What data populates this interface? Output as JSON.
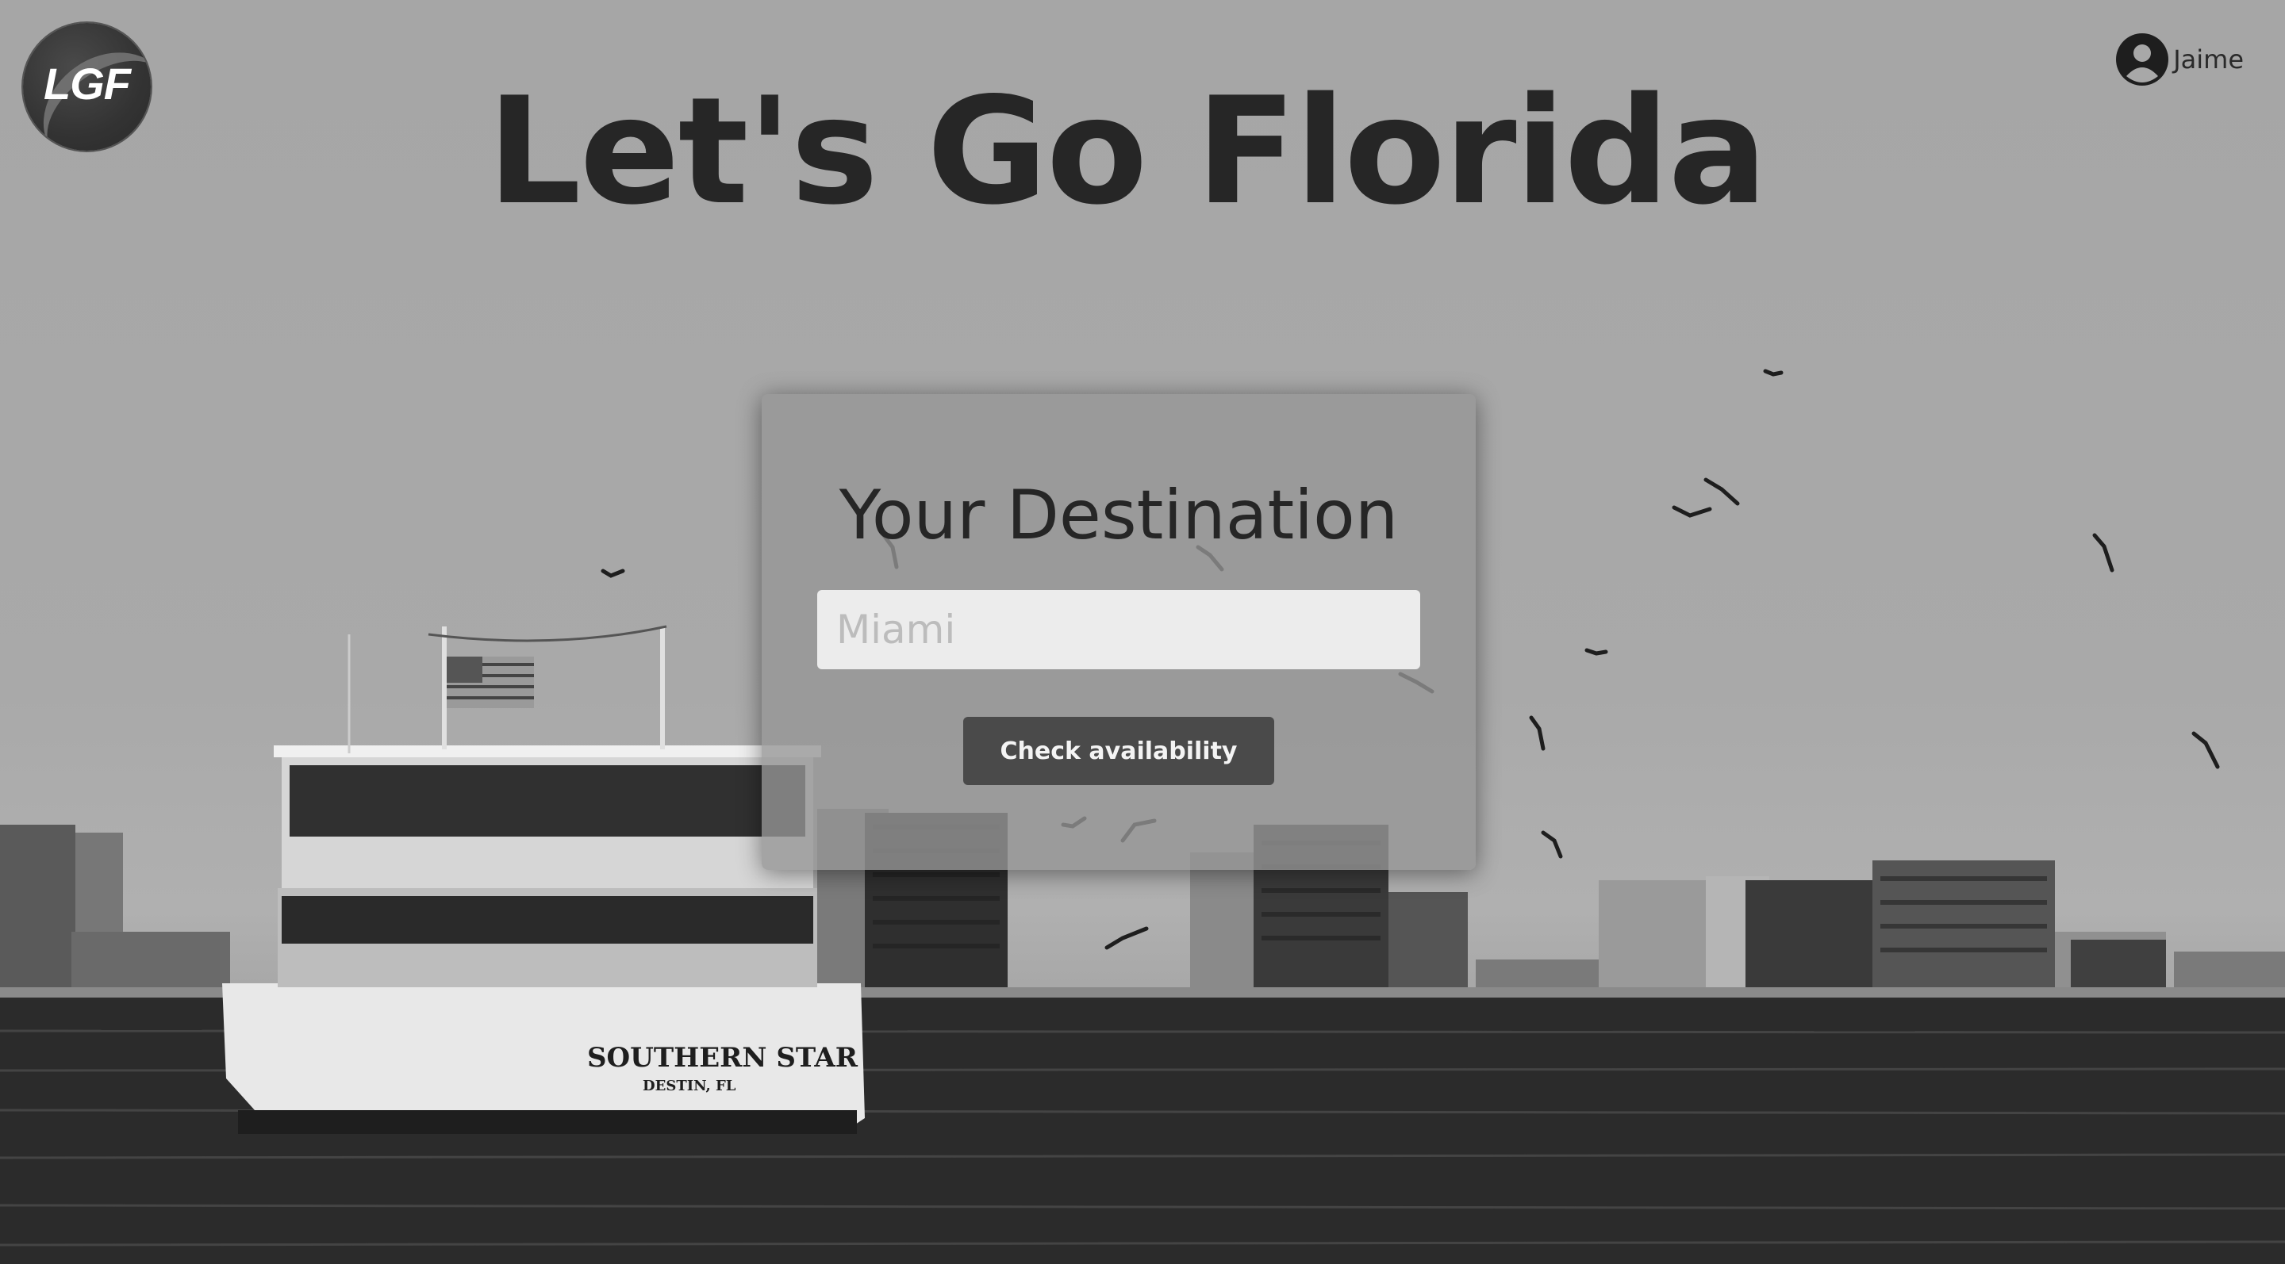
{
  "header": {
    "logo_text": "LGF",
    "site_title": "Let's Go Florida",
    "user": {
      "name": "Jaime",
      "avatar_icon": "user-circle-icon"
    }
  },
  "search_card": {
    "heading": "Your Destination",
    "destination_input": {
      "value": "",
      "placeholder": "Miami"
    },
    "check_button_label": "Check availability"
  },
  "background": {
    "boat_name": "SOUTHERN STAR",
    "boat_port": "DESTIN, FL"
  }
}
